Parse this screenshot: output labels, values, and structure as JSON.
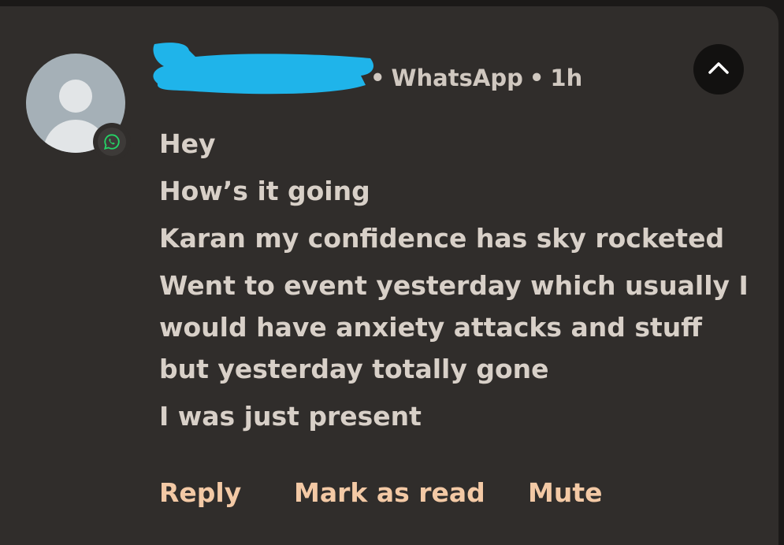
{
  "notification": {
    "app_name": "WhatsApp",
    "separator": "•",
    "time": "1h",
    "avatar_icon": "person-placeholder-icon",
    "badge_icon": "whatsapp-icon",
    "collapse_icon": "chevron-up-icon"
  },
  "messages": [
    "Hey",
    "How’s it going",
    "Karan my confidence has sky rocketed",
    "Went to event yesterday which usually I would have anxiety attacks and stuff but yesterday totally gone",
    "I was just present"
  ],
  "actions": {
    "reply": "Reply",
    "mark_as_read": "Mark as read",
    "mute": "Mute"
  },
  "colors": {
    "card_background": "#302d2b",
    "page_background": "#1b1918",
    "message_text": "#d8d0c8",
    "action_text": "#f3c9a5",
    "redaction": "#1fb4ea",
    "whatsapp_green": "#25d366"
  }
}
